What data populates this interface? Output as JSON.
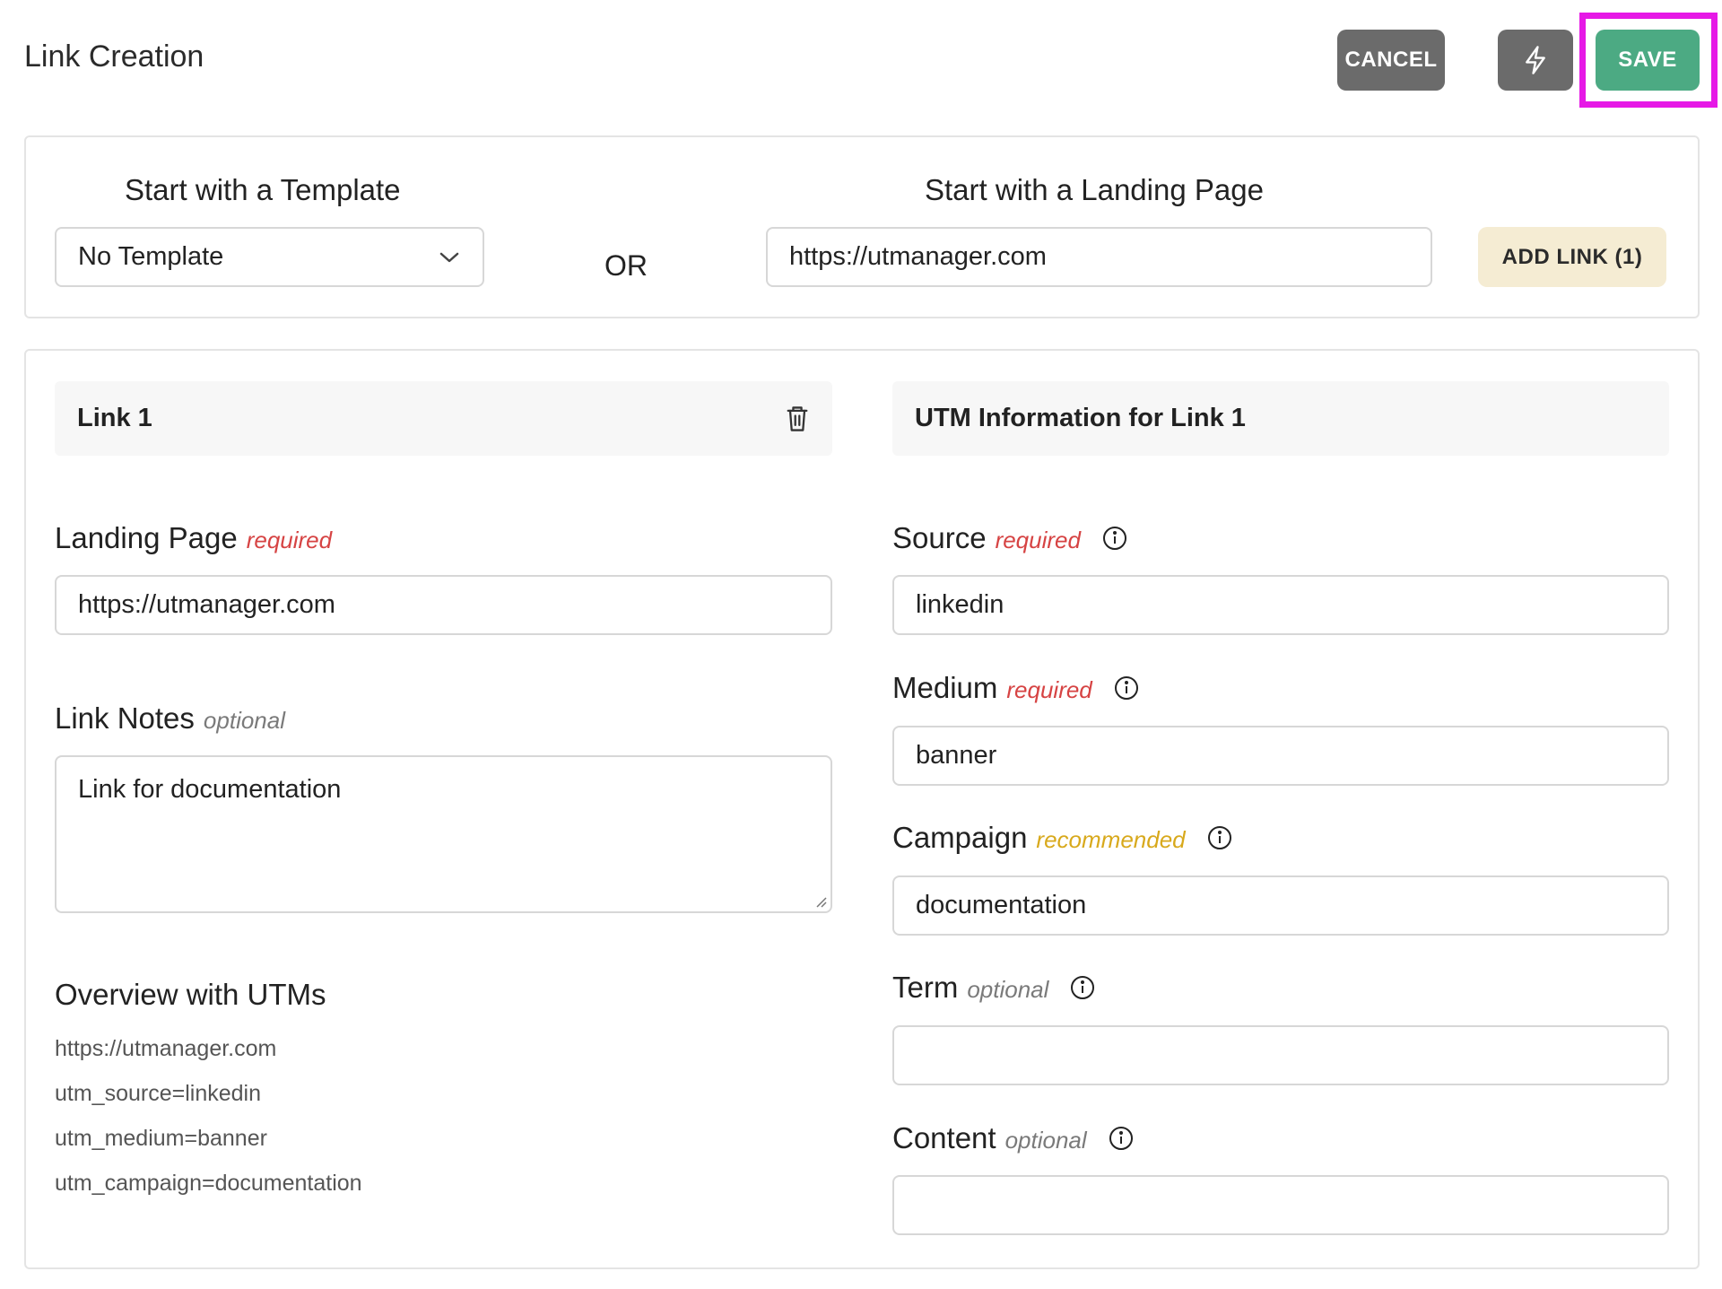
{
  "header": {
    "title": "Link Creation",
    "cancel_label": "CANCEL",
    "save_label": "SAVE",
    "bolt_icon": "lightning-bolt-icon"
  },
  "start": {
    "template_heading": "Start with a Template",
    "template_selected": "No Template",
    "or_label": "OR",
    "landing_heading": "Start with a Landing Page",
    "landing_value": "https://utmanager.com",
    "add_link_label": "ADD LINK (1)"
  },
  "link_panel": {
    "title": "Link 1",
    "landing_page": {
      "label": "Landing Page",
      "tag": "required",
      "value": "https://utmanager.com"
    },
    "notes": {
      "label": "Link Notes",
      "tag": "optional",
      "value": "Link for documentation"
    },
    "overview": {
      "title": "Overview with UTMs",
      "lines": [
        "https://utmanager.com",
        "utm_source=linkedin",
        "utm_medium=banner",
        "utm_campaign=documentation"
      ]
    }
  },
  "utm_panel": {
    "title": "UTM Information for Link 1",
    "fields": [
      {
        "label": "Source",
        "tag": "required",
        "value": "linkedin"
      },
      {
        "label": "Medium",
        "tag": "required",
        "value": "banner"
      },
      {
        "label": "Campaign",
        "tag": "recommended",
        "value": "documentation"
      },
      {
        "label": "Term",
        "tag": "optional",
        "value": ""
      },
      {
        "label": "Content",
        "tag": "optional",
        "value": ""
      }
    ]
  },
  "colors": {
    "save": "#4caa83",
    "cancel": "#6b6b6b",
    "add_link": "#f5ecd3",
    "required": "#d64343",
    "recommended": "#d8a91c",
    "optional": "#7a7a7a",
    "highlight": "#e619e6"
  }
}
